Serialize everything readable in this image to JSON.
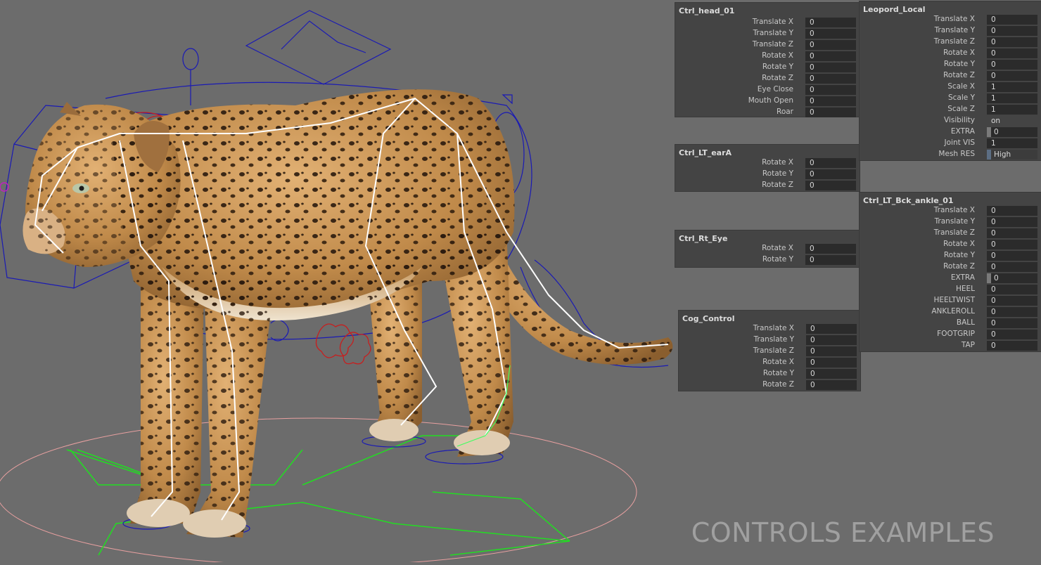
{
  "caption": "CONTROLS EXAMPLES",
  "colors": {
    "viewport_bg": "#6c6c6c",
    "panel_bg": "#444444",
    "field_bg": "#2b2b2b",
    "rig_blue": "#1a1ab4",
    "rig_red": "#c81e1e",
    "rig_green": "#22dd22",
    "rig_pink": "#e8a0a0",
    "joint_white": "#ffffff",
    "leopard_fur": "#c8924e"
  },
  "panels": {
    "head": {
      "title": "Ctrl_head_01",
      "rows": [
        {
          "label": "Translate X",
          "value": "0"
        },
        {
          "label": "Translate Y",
          "value": "0"
        },
        {
          "label": "Translate Z",
          "value": "0"
        },
        {
          "label": "Rotate X",
          "value": "0"
        },
        {
          "label": "Rotate Y",
          "value": "0"
        },
        {
          "label": "Rotate Z",
          "value": "0"
        },
        {
          "label": "Eye Close",
          "value": "0"
        },
        {
          "label": "Mouth Open",
          "value": "0"
        },
        {
          "label": "Roar",
          "value": "0"
        }
      ]
    },
    "ear": {
      "title": "Ctrl_LT_earA",
      "rows": [
        {
          "label": "Rotate X",
          "value": "0"
        },
        {
          "label": "Rotate Y",
          "value": "0"
        },
        {
          "label": "Rotate Z",
          "value": "0"
        }
      ]
    },
    "eye": {
      "title": "Ctrl_Rt_Eye",
      "rows": [
        {
          "label": "Rotate X",
          "value": "0"
        },
        {
          "label": "Rotate Y",
          "value": "0"
        }
      ]
    },
    "cog": {
      "title": "Cog_Control",
      "rows": [
        {
          "label": "Translate X",
          "value": "0"
        },
        {
          "label": "Translate Y",
          "value": "0"
        },
        {
          "label": "Translate Z",
          "value": "0"
        },
        {
          "label": "Rotate X",
          "value": "0"
        },
        {
          "label": "Rotate Y",
          "value": "0"
        },
        {
          "label": "Rotate Z",
          "value": "0"
        }
      ]
    },
    "local": {
      "title": "Leopord_Local",
      "rows": [
        {
          "label": "Translate X",
          "value": "0"
        },
        {
          "label": "Translate Y",
          "value": "0"
        },
        {
          "label": "Translate Z",
          "value": "0"
        },
        {
          "label": "Rotate X",
          "value": "0"
        },
        {
          "label": "Rotate Y",
          "value": "0"
        },
        {
          "label": "Rotate Z",
          "value": "0"
        },
        {
          "label": "Scale X",
          "value": "1"
        },
        {
          "label": "Scale Y",
          "value": "1"
        },
        {
          "label": "Scale Z",
          "value": "1"
        },
        {
          "label": "Visibility",
          "value": "on"
        },
        {
          "label": "EXTRA",
          "value": "0"
        },
        {
          "label": "Joint VIS",
          "value": "1"
        },
        {
          "label": "Mesh RES",
          "value": "High"
        }
      ]
    },
    "ankle": {
      "title": "Ctrl_LT_Bck_ankle_01",
      "rows": [
        {
          "label": "Translate X",
          "value": "0"
        },
        {
          "label": "Translate Y",
          "value": "0"
        },
        {
          "label": "Translate Z",
          "value": "0"
        },
        {
          "label": "Rotate X",
          "value": "0"
        },
        {
          "label": "Rotate Y",
          "value": "0"
        },
        {
          "label": "Rotate Z",
          "value": "0"
        },
        {
          "label": "EXTRA",
          "value": "0"
        },
        {
          "label": "HEEL",
          "value": "0"
        },
        {
          "label": "HEELTWIST",
          "value": "0"
        },
        {
          "label": "ANKLEROLL",
          "value": "0"
        },
        {
          "label": "BALL",
          "value": "0"
        },
        {
          "label": "FOOTGRIP",
          "value": "0"
        },
        {
          "label": "TAP",
          "value": "0"
        }
      ]
    }
  }
}
